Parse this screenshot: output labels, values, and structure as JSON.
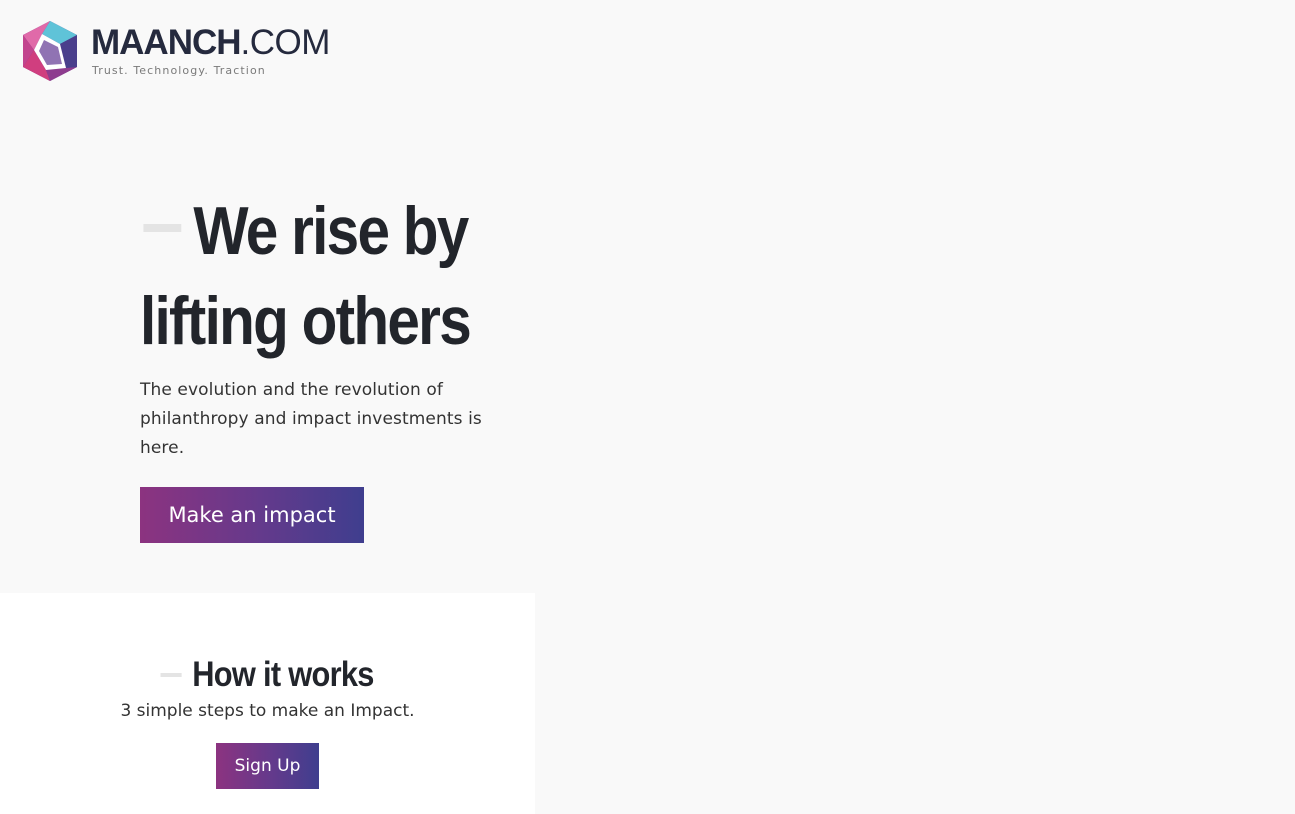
{
  "header": {
    "brand_strong": "MAANCH",
    "brand_light": ".COM",
    "tagline": "Trust. Technology. Traction",
    "logo_icon": "hexagon-logo-icon"
  },
  "hero": {
    "title_line1": "We rise by",
    "title_line2": "lifting others",
    "subtitle": "The evolution and the revolution of philanthropy and impact investments is here.",
    "cta_label": "Make an impact"
  },
  "how_it_works": {
    "title": "How it works",
    "subtitle": "3 simple steps to make an Impact.",
    "signup_label": "Sign Up"
  },
  "colors": {
    "background": "#f9f9f9",
    "gradient_start": "#8c3380",
    "gradient_end": "#3f3e8e",
    "heading": "#22252b"
  }
}
